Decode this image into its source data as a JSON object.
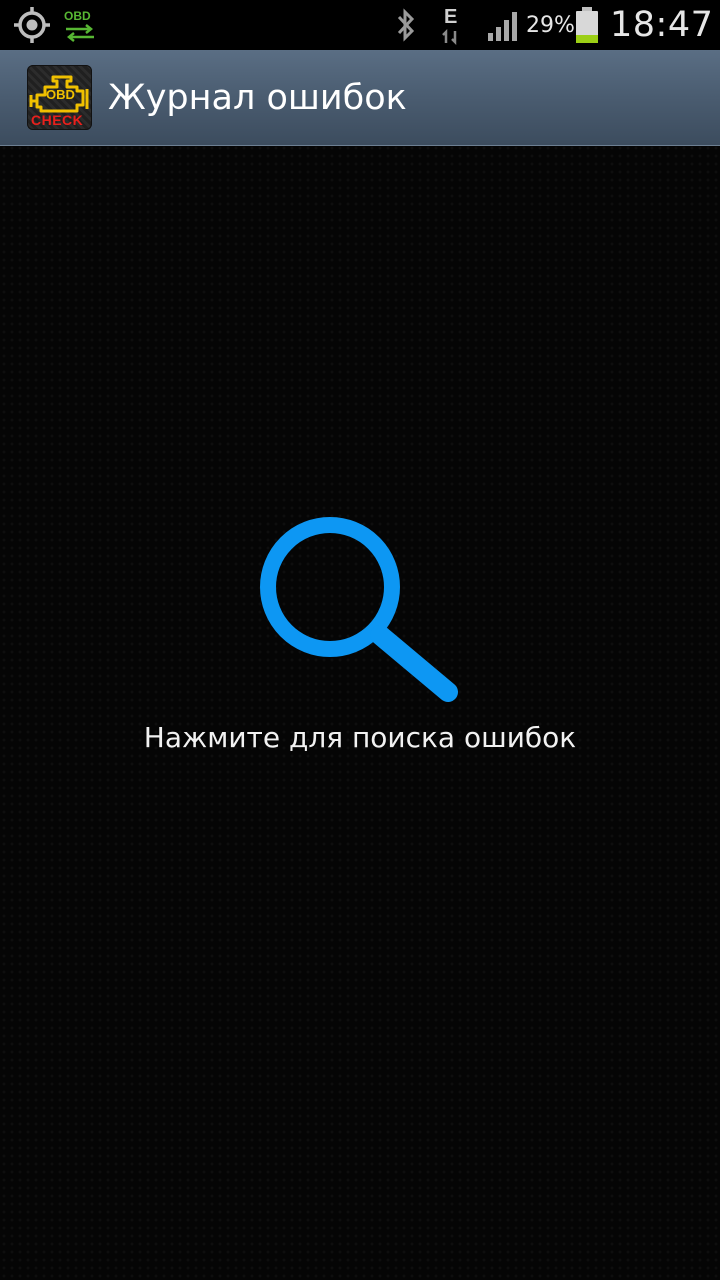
{
  "status_bar": {
    "notification_icons": [
      "gps-icon",
      "obd-icon"
    ],
    "obd_label": "OBD",
    "network_type": "E",
    "battery_percent": "29%",
    "battery_level": 0.29,
    "time": "18:47"
  },
  "action_bar": {
    "title": "Журнал ошибок",
    "icon": "obd-check-engine-icon",
    "icon_text_top": "OBD",
    "icon_text_bottom": "CHECK"
  },
  "content": {
    "search_icon": "search-icon",
    "hint": "Нажмите для поиска ошибок"
  },
  "colors": {
    "accent": "#0d97f3",
    "action_bar": "#4a5c70",
    "battery": "#9ccf16",
    "obd_green": "#57b733",
    "engine_yellow": "#f0c000",
    "check_red": "#e8201c"
  }
}
